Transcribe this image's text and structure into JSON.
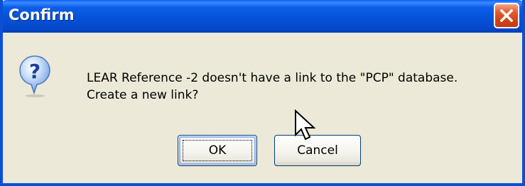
{
  "window": {
    "title": "Confirm",
    "close_icon": "close-icon",
    "title_color": "#ffffff",
    "titlebar_color": "#0552d8",
    "close_button_color": "#d04416"
  },
  "dialog": {
    "icon": "question-icon",
    "message_lines": [
      "LEAR Reference -2 doesn't have a link to the \"PCP\" database.",
      "Create a new link?"
    ],
    "background_color": "#ece9d8"
  },
  "buttons": {
    "ok_label": "OK",
    "cancel_label": "Cancel",
    "default": "OK"
  },
  "cursor": {
    "icon": "mouse-pointer-icon"
  }
}
